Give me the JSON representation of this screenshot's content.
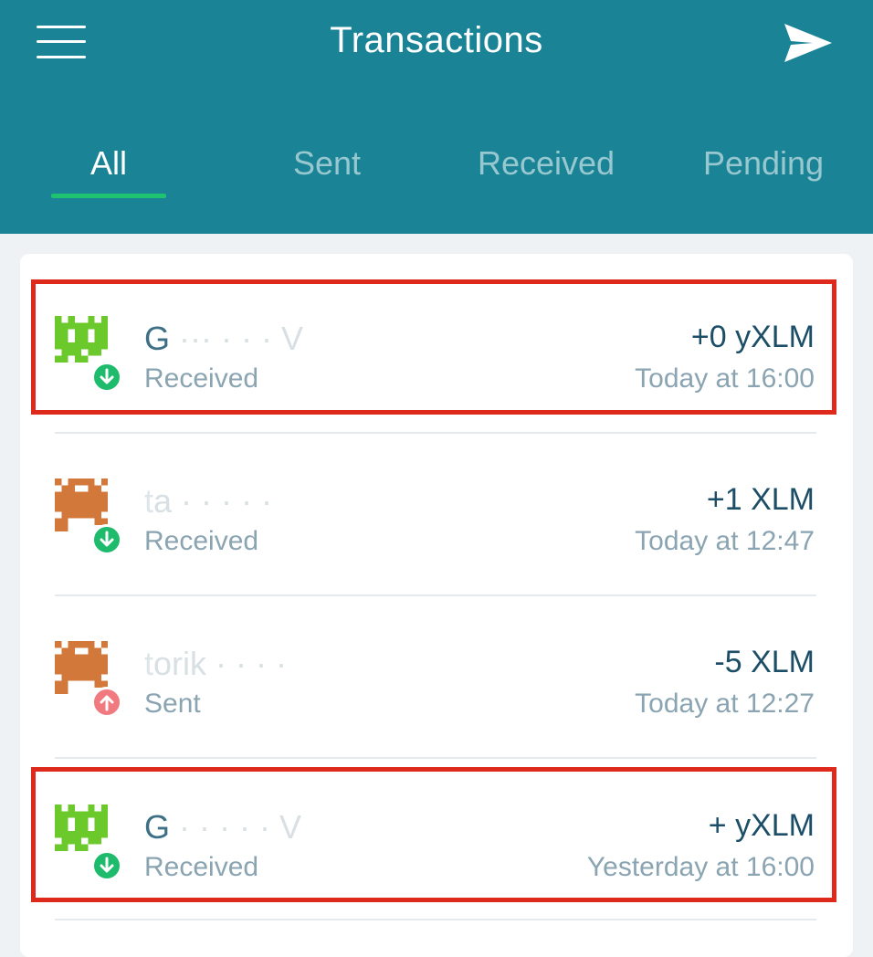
{
  "header": {
    "title": "Transactions",
    "menu_icon": "hamburger-menu-icon",
    "send_icon": "paper-plane-icon",
    "background": "#1a8396"
  },
  "tabs": [
    {
      "label": "All",
      "active": true
    },
    {
      "label": "Sent",
      "active": false
    },
    {
      "label": "Received",
      "active": false
    },
    {
      "label": "Pending",
      "active": false
    }
  ],
  "transactions": [
    {
      "name_lead": "G",
      "name_rest": "  ···  ·  ·  · V",
      "type": "Received",
      "amount": "+0  yXLM",
      "time": "Today at 16:00",
      "avatar": "green-pixel-avatar",
      "direction": "received",
      "highlighted": true
    },
    {
      "name_lead": "t",
      "name_rest": "a  ·  ·  ·  ·  ·",
      "type": "Received",
      "amount": "+1 XLM",
      "time": "Today at 12:47",
      "avatar": "orange-pixel-avatar",
      "direction": "received",
      "highlighted": false
    },
    {
      "name_lead": "t",
      "name_rest": "orik  ·  ·  ·  ·",
      "type": "Sent",
      "amount": "-5 XLM",
      "time": "Today at 12:27",
      "avatar": "orange-pixel-avatar",
      "direction": "sent",
      "highlighted": false
    },
    {
      "name_lead": "G",
      "name_rest": "  ·  ·  ·  ·  · V",
      "type": "Received",
      "amount": "+   yXLM",
      "time": "Yesterday at 16:00",
      "avatar": "green-pixel-avatar",
      "direction": "received",
      "highlighted": true
    }
  ],
  "colors": {
    "accent_underline": "#1fc26f",
    "received_badge": "#1fbb6c",
    "sent_badge": "#f17a80",
    "highlight_box": "#dd2a1c"
  }
}
